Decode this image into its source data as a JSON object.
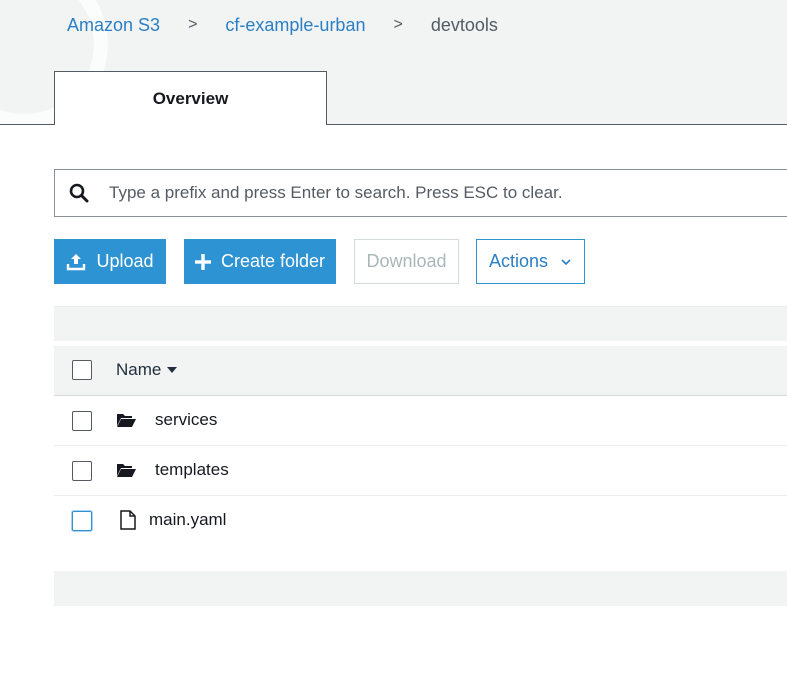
{
  "breadcrumb": {
    "root": "Amazon S3",
    "bucket": "cf-example-urban",
    "current": "devtools",
    "separator": ">"
  },
  "tabs": [
    {
      "label": "Overview",
      "selected": true
    }
  ],
  "search": {
    "placeholder": "Type a prefix and press Enter to search. Press ESC to clear.",
    "value": ""
  },
  "toolbar": {
    "upload_label": "Upload",
    "create_folder_label": "Create folder",
    "download_label": "Download",
    "actions_label": "Actions"
  },
  "table": {
    "column_header": "Name",
    "sort_icon": "caret-down-icon",
    "rows": [
      {
        "type": "folder",
        "icon": "folder-open-icon",
        "name": "services"
      },
      {
        "type": "folder",
        "icon": "folder-open-icon",
        "name": "templates"
      },
      {
        "type": "file",
        "icon": "file-icon",
        "name": "main.yaml"
      }
    ]
  },
  "colors": {
    "accent": "#2e93d3",
    "link": "#2b7fc4",
    "disabled_text": "#aab7b8",
    "band": "#f2f3f3"
  }
}
